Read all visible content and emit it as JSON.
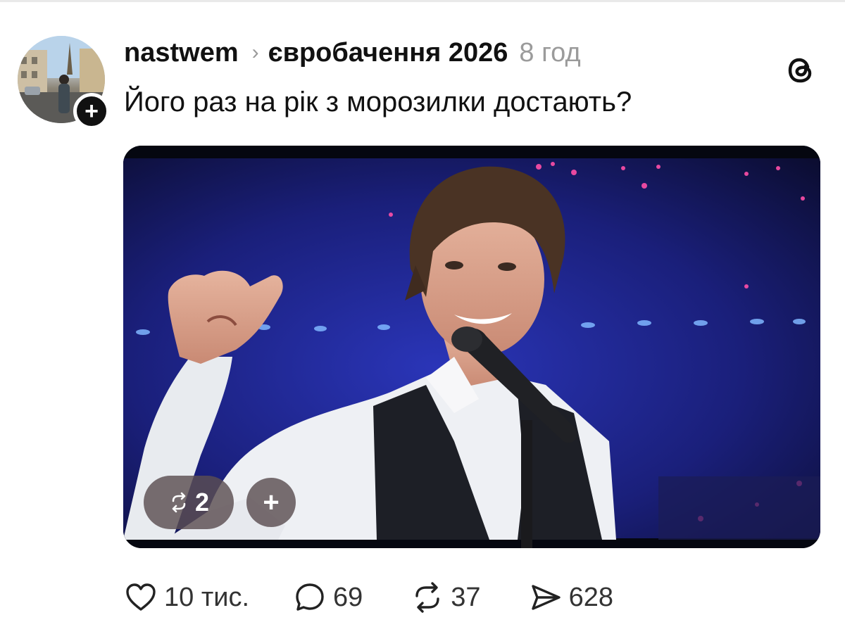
{
  "post": {
    "username": "nastwem",
    "topic": "євробачення 2026",
    "time": "8 год",
    "text": "Його раз на рік з морозилки достають?"
  },
  "media": {
    "repost_count": "2"
  },
  "actions": {
    "likes": "10 тис.",
    "replies": "69",
    "reposts": "37",
    "shares": "628"
  },
  "icons": {
    "follow": "plus-icon",
    "app": "threads-logo-icon",
    "like": "heart-icon",
    "reply": "speech-bubble-icon",
    "repost": "repost-arrows-icon",
    "share": "paper-plane-icon"
  },
  "colors": {
    "text": "#111111",
    "muted": "#9b9b9b",
    "pill": "#5c4e52"
  }
}
